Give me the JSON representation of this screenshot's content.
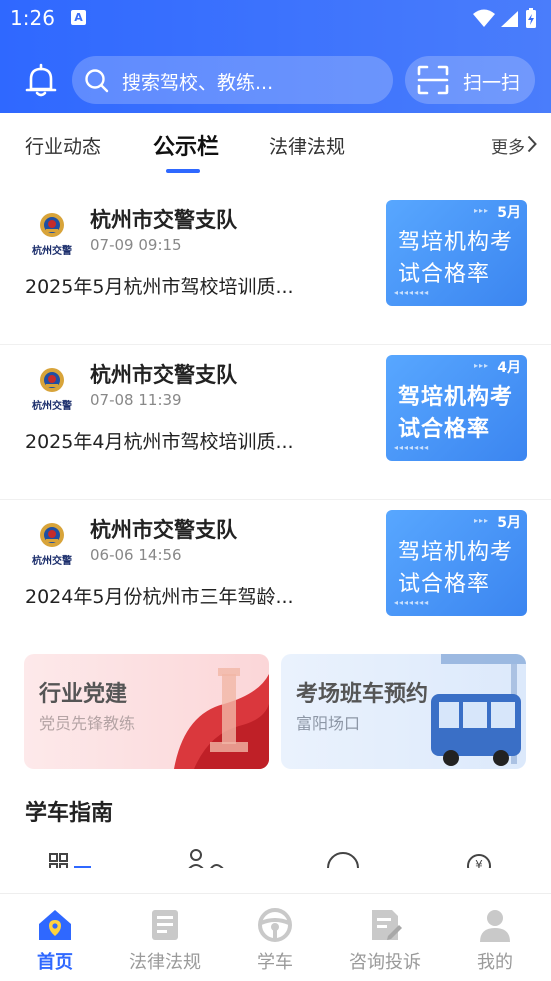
{
  "status_bar": {
    "time": "1:26",
    "notification_badge": "A"
  },
  "header": {
    "search_placeholder": "搜索驾校、教练...",
    "scan_label": "扫一扫"
  },
  "tabs": {
    "items": [
      {
        "label": "行业动态"
      },
      {
        "label": "公示栏"
      },
      {
        "label": "法律法规"
      }
    ],
    "active_index": 1,
    "more_label": "更多"
  },
  "news": [
    {
      "author": "杭州市交警支队",
      "emblem_text": "杭州交警",
      "time": "07-09 09:15",
      "title": "2025年5月杭州市驾校培训质...",
      "thumb_month": "5月",
      "thumb_line1": "驾培机构考",
      "thumb_line2": "试合格率"
    },
    {
      "author": "杭州市交警支队",
      "emblem_text": "杭州交警",
      "time": "07-08 11:39",
      "title": "2025年4月杭州市驾校培训质...",
      "thumb_month": "4月",
      "thumb_line1": "驾培机构考",
      "thumb_line2": "试合格率"
    },
    {
      "author": "杭州市交警支队",
      "emblem_text": "杭州交警",
      "time": "06-06 14:56",
      "title": "2024年5月份杭州市三年驾龄...",
      "thumb_month": "5月",
      "thumb_line1": "驾培机构考",
      "thumb_line2": "试合格率"
    }
  ],
  "banners": {
    "left": {
      "title": "行业党建",
      "subtitle": "党员先锋教练"
    },
    "right": {
      "title": "考场班车预约",
      "subtitle": "富阳场口"
    }
  },
  "section": {
    "title": "学车指南"
  },
  "bottom_nav": {
    "items": [
      {
        "label": "首页",
        "icon": "home-icon"
      },
      {
        "label": "法律法规",
        "icon": "law-book-icon"
      },
      {
        "label": "学车",
        "icon": "steering-wheel-icon"
      },
      {
        "label": "咨询投诉",
        "icon": "complaint-icon"
      },
      {
        "label": "我的",
        "icon": "profile-icon"
      }
    ],
    "active_index": 0
  },
  "colors": {
    "primary": "#2f68ff",
    "thumb": "#3b85f0",
    "party_red": "#d6262b"
  }
}
